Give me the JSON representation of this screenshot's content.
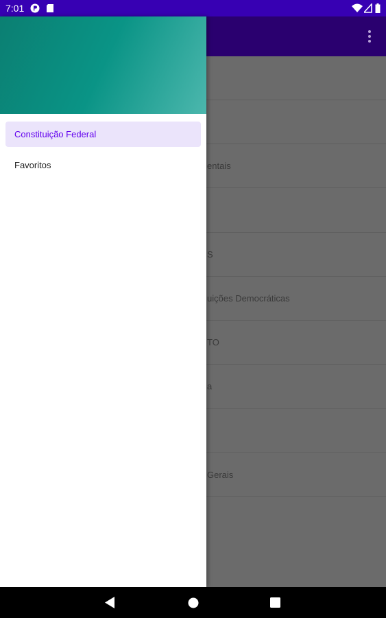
{
  "statusbar": {
    "time": "7:01",
    "left_icons": [
      "p-notification-icon",
      "sd-card-icon"
    ],
    "right_icons": [
      "wifi-icon",
      "signal-icon",
      "battery-icon"
    ]
  },
  "appbar": {
    "background": "#2a006f",
    "overflow_icon": "more-vert-icon"
  },
  "list": {
    "rows": [
      {
        "label": ""
      },
      {
        "label": ""
      },
      {
        "label": "entais"
      },
      {
        "label": ""
      },
      {
        "label": "S"
      },
      {
        "label": "uições Democráticas"
      },
      {
        "label": "TO"
      },
      {
        "label": "a"
      },
      {
        "label": ""
      },
      {
        "label": "Gerais"
      }
    ]
  },
  "drawer": {
    "header_colors": [
      "#0b7f72",
      "#4cb7ad"
    ],
    "items": [
      {
        "label": "Constituição Federal",
        "selected": true
      },
      {
        "label": "Favoritos",
        "selected": false
      }
    ],
    "accent": "#6200ee",
    "selected_bg": "#ebe4fb"
  },
  "navbar": {
    "buttons": [
      "back-icon",
      "home-icon",
      "recents-icon"
    ]
  }
}
